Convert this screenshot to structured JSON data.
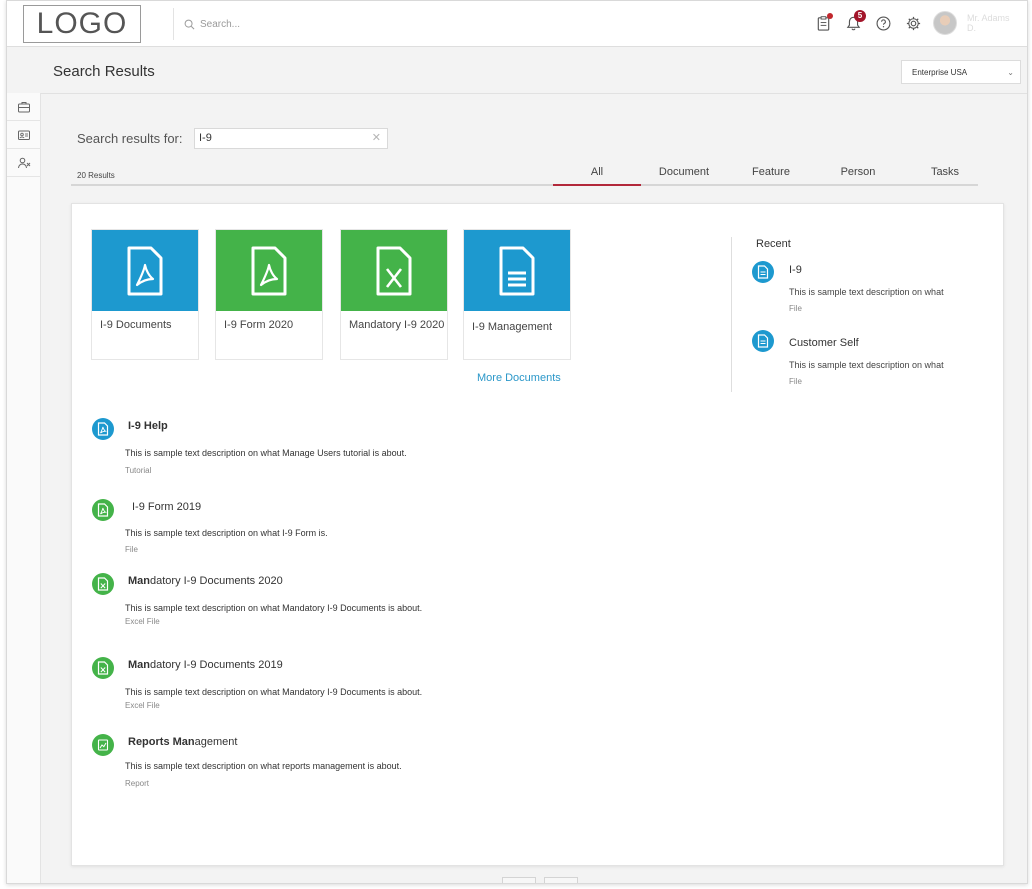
{
  "header": {
    "logo_text": "LOGO",
    "search_placeholder": "Search...",
    "notification_count": "5",
    "user_name": "Mr. Adams D."
  },
  "page": {
    "title": "Search Results",
    "org_selector": "Enterprise USA"
  },
  "search": {
    "label": "Search results for:",
    "query": "I-9",
    "result_count": "20 Results"
  },
  "tabs": [
    {
      "label": "All",
      "active": true
    },
    {
      "label": "Document",
      "active": false
    },
    {
      "label": "Feature",
      "active": false
    },
    {
      "label": "Person",
      "active": false
    },
    {
      "label": "Tasks",
      "active": false
    }
  ],
  "documents": [
    {
      "label": "I-9 Documents",
      "icon": "pdf-icon",
      "color": "#1d99cf"
    },
    {
      "label": "I-9 Form 2020",
      "icon": "pdf-icon",
      "color": "#44b349"
    },
    {
      "label": "Mandatory I-9 2020",
      "icon": "excel-icon",
      "color": "#44b349"
    },
    {
      "label": "I-9 Management",
      "icon": "document-icon",
      "color": "#1d99cf"
    }
  ],
  "more_documents_label": "More Documents",
  "recent": {
    "title": "Recent",
    "items": [
      {
        "title": "I-9",
        "description": "This is sample text description on what",
        "type": "File"
      },
      {
        "title": "Customer Self",
        "description": "This is sample text description on what",
        "type": "File"
      }
    ]
  },
  "results": [
    {
      "title": "I-9 Help",
      "description": "This is sample text description on what Manage Users tutorial is about.",
      "type": "Tutorial",
      "icon": "pdf-icon",
      "color": "#1d99cf"
    },
    {
      "title": "I-9 Form 2019",
      "description": "This is sample text description on what I-9 Form is.",
      "type": "File",
      "icon": "pdf-icon",
      "color": "#44b349"
    },
    {
      "title_bold": "Man",
      "title": "datory I-9 Documents 2020",
      "description": "This is sample text description on what Mandatory I-9 Documents is about.",
      "type": "Excel File",
      "icon": "excel-icon",
      "color": "#44b349"
    },
    {
      "title_bold": "Man",
      "title": "datory I-9 Documents 2019",
      "description": "This is sample text description on what Mandatory I-9 Documents is about.",
      "type": "Excel File",
      "icon": "excel-icon",
      "color": "#44b349"
    },
    {
      "title_bold": "Reports Man",
      "title": "agement",
      "description": "This is sample text description on what reports management is about.",
      "type": "Report",
      "icon": "report-icon",
      "color": "#44b349"
    }
  ],
  "colors": {
    "accent_blue": "#1d99cf",
    "accent_green": "#44b349",
    "active_tab": "#b2283a",
    "notification_red": "#a3152a"
  }
}
